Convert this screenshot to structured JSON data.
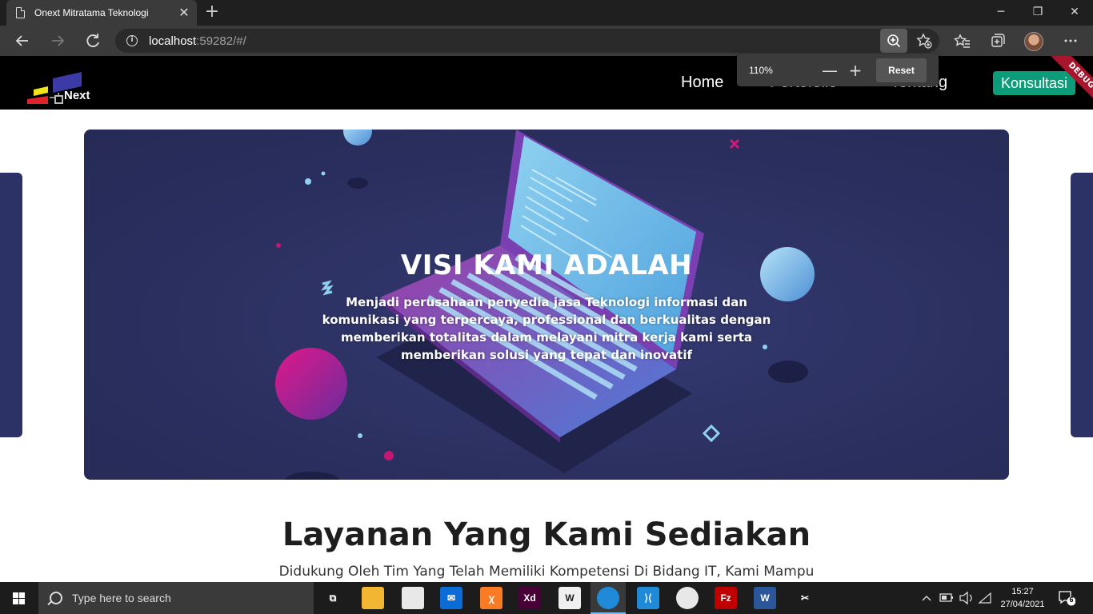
{
  "browser": {
    "tab_title": "Onext Mitratama Teknologi",
    "tab_close": "✕",
    "new_tab": "+",
    "url_host": "localhost",
    "url_rest": ":59282/#/",
    "controls": {
      "minimize": "─",
      "maximize": "❐",
      "close": "✕"
    },
    "zoom": {
      "level": "110%",
      "minus": "—",
      "plus": "+",
      "reset": "Reset"
    }
  },
  "site": {
    "logo_text": "Next",
    "nav": [
      "Home",
      "Portofolio",
      "Tentang"
    ],
    "cta": "Konsultasi",
    "debug_banner": "DEBUG"
  },
  "hero": {
    "title": "VISI KAMI ADALAH",
    "text": "Menjadi perusahaan penyedia jasa Teknologi informasi dan komunikasi yang terpercaya, professional dan berkualitas dengan memberikan totalitas dalam melayani mitra kerja kami serta memberikan solusi yang tepat dan inovatif"
  },
  "services": {
    "title": "Layanan Yang Kami Sediakan",
    "subtitle": "Didukung Oleh Tim Yang Telah Memiliki Kompetensi Di Bidang IT, Kami Mampu"
  },
  "taskbar": {
    "search_placeholder": "Type here to search",
    "apps": [
      {
        "name": "task-view",
        "label": "⧉",
        "color": "#1c1c1c"
      },
      {
        "name": "file-explorer",
        "label": "",
        "color": "#f2b632"
      },
      {
        "name": "store",
        "label": "",
        "color": "#e8e8e8"
      },
      {
        "name": "mail",
        "label": "✉",
        "color": "#0a6cd6"
      },
      {
        "name": "xampp",
        "label": "ꭓ",
        "color": "#fb7a24"
      },
      {
        "name": "adobe-xd",
        "label": "Xd",
        "color": "#470137"
      },
      {
        "name": "app-w",
        "label": "W",
        "color": "#f0f0f0"
      },
      {
        "name": "edge",
        "label": "",
        "color": "#1f8ad8"
      },
      {
        "name": "vscode",
        "label": "⟩⟨",
        "color": "#1f8ad8"
      },
      {
        "name": "chrome",
        "label": "",
        "color": "#e8e8e8"
      },
      {
        "name": "filezilla",
        "label": "Fz",
        "color": "#bf0000"
      },
      {
        "name": "word",
        "label": "W",
        "color": "#2b579a"
      },
      {
        "name": "paint-tool",
        "label": "✂",
        "color": "#1c1c1c"
      }
    ],
    "time": "15:27",
    "date": "27/04/2021",
    "notification_count": "6"
  }
}
